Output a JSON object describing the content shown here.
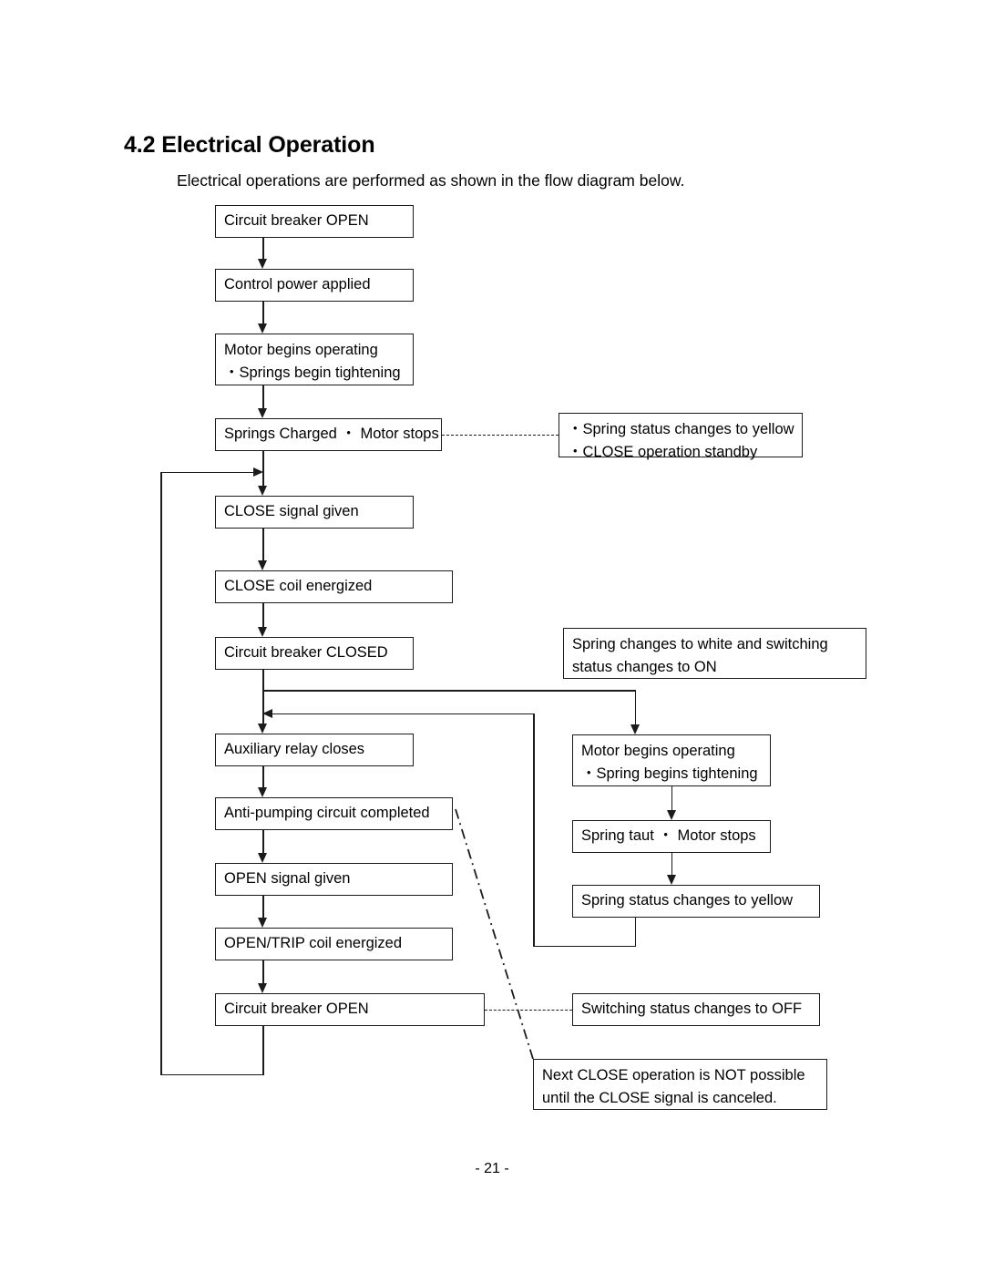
{
  "page": {
    "section_number_title": "4.2 Electrical Operation",
    "intro": "Electrical operations are performed as shown in the flow diagram below.",
    "page_number": "- 21 -"
  },
  "colors": {
    "line": "#1b1b1b",
    "box_fill": "#ffffff",
    "text": "#000000",
    "page_background": "#ffffff"
  },
  "flow": {
    "main_column": [
      {
        "id": "circuit-breaker-open-top",
        "label": "Circuit breaker OPEN"
      },
      {
        "id": "control-power-applied",
        "label": "Control power applied"
      },
      {
        "id": "motor-begins-operating-left",
        "label": "Motor begins operating\n ・Springs begin tightening"
      },
      {
        "id": "springs-charged-motor-stops",
        "label": "Springs Charged ・ Motor stops"
      },
      {
        "id": "close-signal-given",
        "label": "CLOSE signal given"
      },
      {
        "id": "close-coil-energized",
        "label": "CLOSE coil energized"
      },
      {
        "id": "circuit-breaker-closed",
        "label": "Circuit breaker CLOSED"
      },
      {
        "id": "auxiliary-relay-closes",
        "label": "Auxiliary relay closes"
      },
      {
        "id": "anti-pumping-circuit-completed",
        "label": "Anti-pumping circuit completed"
      },
      {
        "id": "open-signal-given",
        "label": "OPEN signal given"
      },
      {
        "id": "open-trip-coil-energized",
        "label": "OPEN/TRIP coil energized"
      },
      {
        "id": "circuit-breaker-open-bottom",
        "label": "Circuit breaker OPEN"
      }
    ],
    "right_column": [
      {
        "id": "spring-status-yellow-standby",
        "label": "・Spring status changes to yellow\n・CLOSE operation standby"
      },
      {
        "id": "spring-white-switching-on",
        "label": "Spring changes to white and switching\nstatus changes to ON"
      },
      {
        "id": "motor-begins-operating-right",
        "label": "Motor begins operating\n ・Spring begins tightening"
      },
      {
        "id": "spring-taut-motor-stops",
        "label": "Spring taut ・ Motor stops"
      },
      {
        "id": "spring-status-changes-yellow",
        "label": "Spring status changes to yellow"
      },
      {
        "id": "switching-status-off",
        "label": "Switching status changes to OFF"
      },
      {
        "id": "next-close-not-possible",
        "label": "Next CLOSE operation is NOT possible\nuntil the CLOSE signal is canceled."
      }
    ]
  }
}
